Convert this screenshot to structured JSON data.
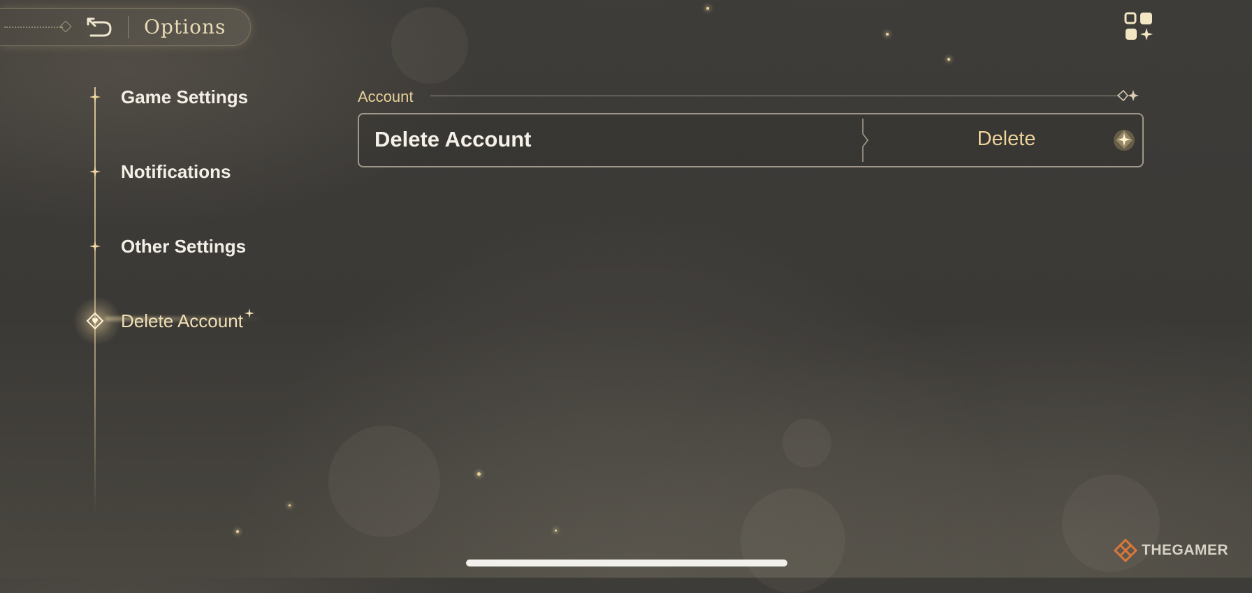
{
  "header": {
    "title": "Options",
    "back_icon": "back-arrow-icon",
    "menu_icon": "grid-menu-icon"
  },
  "sidebar": {
    "items": [
      {
        "label": "Game Settings",
        "active": false
      },
      {
        "label": "Notifications",
        "active": false
      },
      {
        "label": "Other Settings",
        "active": false
      },
      {
        "label": "Delete Account",
        "active": true
      }
    ]
  },
  "main": {
    "section_title": "Account",
    "rows": [
      {
        "label": "Delete Account",
        "action_label": "Delete"
      }
    ]
  },
  "watermark": {
    "text": "THEGAMER"
  },
  "colors": {
    "accent": "#e8cf98",
    "text": "#f4efe6",
    "background": "#3e3c39",
    "watermark_accent": "#d9773a"
  }
}
